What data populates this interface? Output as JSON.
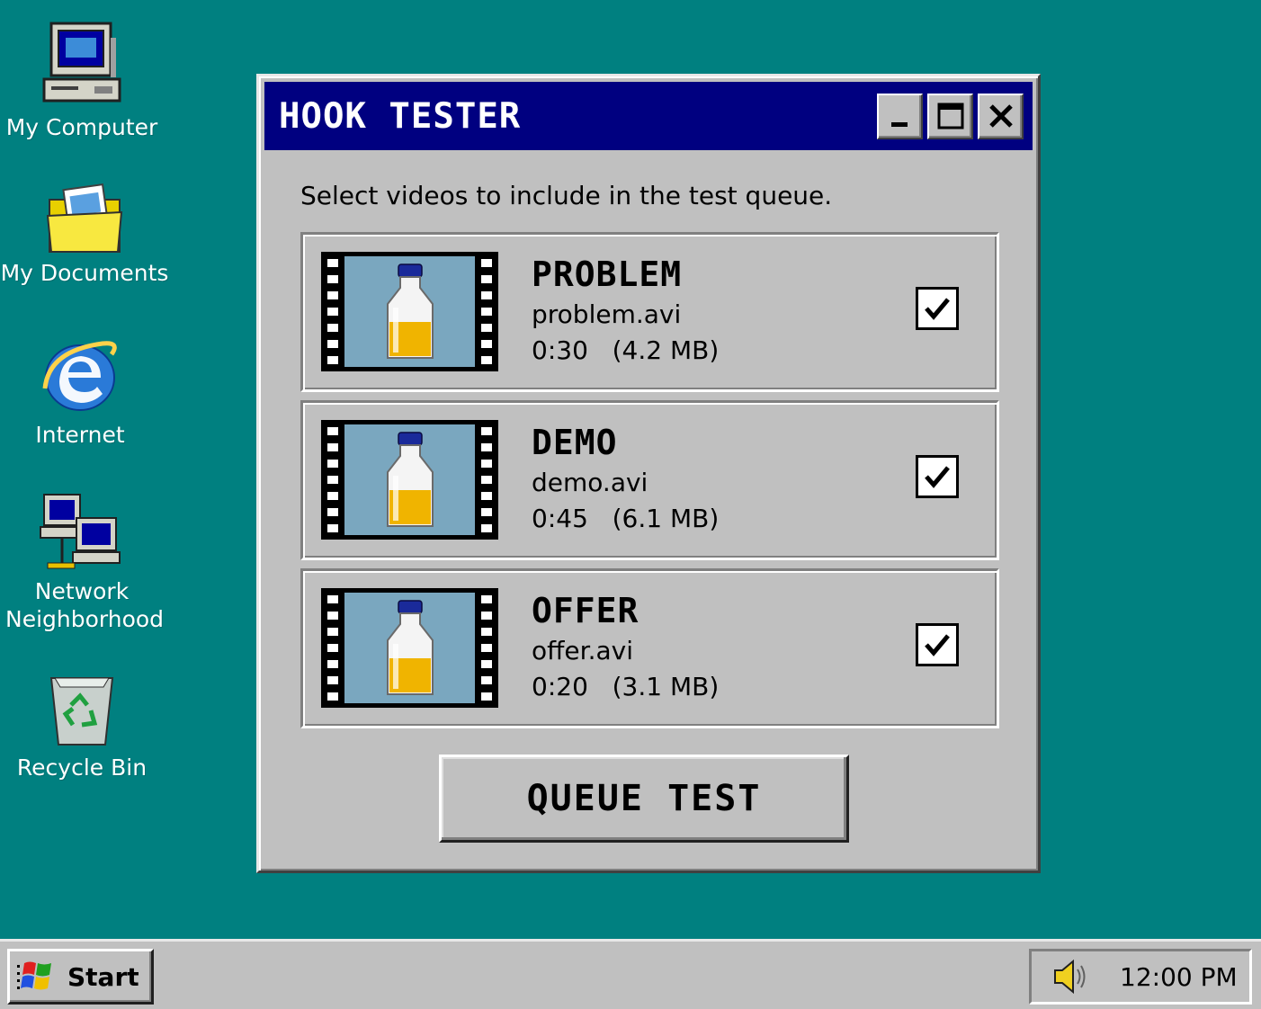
{
  "desktop": {
    "icons": [
      {
        "label": "My Computer"
      },
      {
        "label": "My Documents"
      },
      {
        "label": "Internet"
      },
      {
        "label": "Network Neighborhood"
      },
      {
        "label": "Recycle Bin"
      }
    ]
  },
  "window": {
    "title": "HOOK TESTER",
    "instructions": "Select videos to include in the test queue.",
    "videos": [
      {
        "name": "PROBLEM",
        "file": "problem.avi",
        "duration": "0:30",
        "size": "(4.2 MB)",
        "checked": true
      },
      {
        "name": "DEMO",
        "file": "demo.avi",
        "duration": "0:45",
        "size": "(6.1 MB)",
        "checked": true
      },
      {
        "name": "OFFER",
        "file": "offer.avi",
        "duration": "0:20",
        "size": "(3.1 MB)",
        "checked": true
      }
    ],
    "queue_button": "QUEUE TEST"
  },
  "taskbar": {
    "start_label": "Start",
    "clock": "12:00 PM"
  },
  "colors": {
    "desktop": "#008080",
    "titlebar": "#000080",
    "face": "#c0c0c0",
    "thumb_bg": "#7aa7bf",
    "liquid": "#f0b400",
    "cap": "#1a2a9a"
  }
}
